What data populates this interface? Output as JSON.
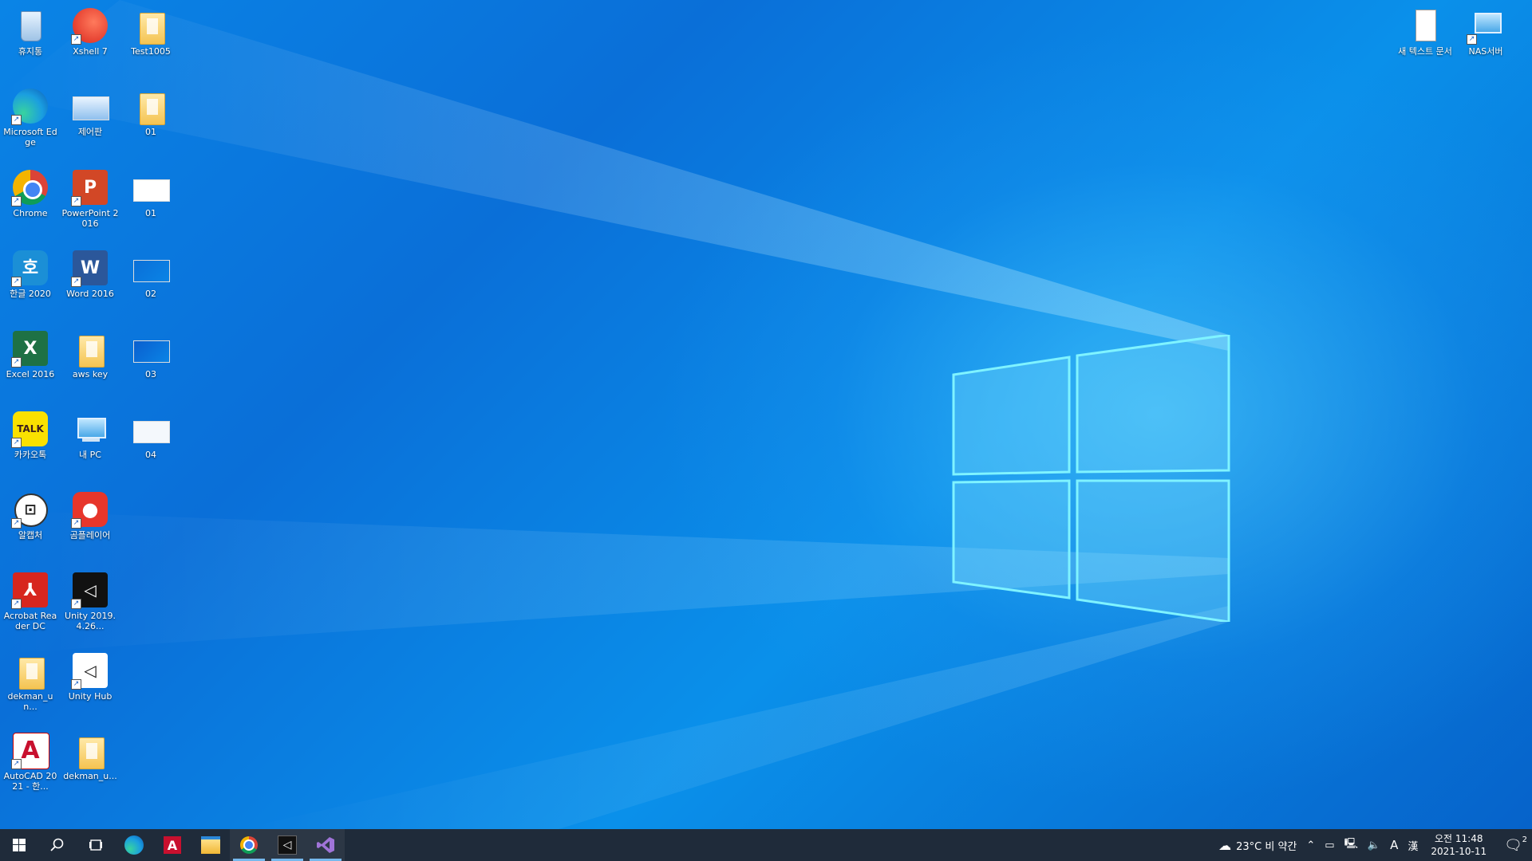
{
  "desktop": {
    "icons_left_col1": [
      {
        "label": "휴지통",
        "icon": "recycle-bin-icon"
      },
      {
        "label": "Microsoft Edge",
        "icon": "edge-icon"
      },
      {
        "label": "Chrome",
        "icon": "chrome-icon"
      },
      {
        "label": "한글 2020",
        "icon": "hangul-icon"
      },
      {
        "label": "Excel 2016",
        "icon": "excel-icon"
      },
      {
        "label": "카카오톡",
        "icon": "kakaotalk-icon"
      },
      {
        "label": "알캡처",
        "icon": "alcapture-icon"
      },
      {
        "label": "Acrobat Reader DC",
        "icon": "acrobat-icon"
      },
      {
        "label": "dekman_un...",
        "icon": "folder-icon"
      },
      {
        "label": "AutoCAD 2021 - 한...",
        "icon": "autocad-icon"
      }
    ],
    "icons_left_col2": [
      {
        "label": "Xshell 7",
        "icon": "xshell-icon"
      },
      {
        "label": "제어판",
        "icon": "control-panel-icon"
      },
      {
        "label": "PowerPoint 2016",
        "icon": "powerpoint-icon"
      },
      {
        "label": "Word 2016",
        "icon": "word-icon"
      },
      {
        "label": "aws key",
        "icon": "folder-icon"
      },
      {
        "label": "내 PC",
        "icon": "this-pc-icon"
      },
      {
        "label": "곰플레이어",
        "icon": "gomplayer-icon"
      },
      {
        "label": "Unity 2019.4.26...",
        "icon": "unity-icon"
      },
      {
        "label": "Unity Hub",
        "icon": "unity-hub-icon"
      },
      {
        "label": "dekman_u...",
        "icon": "folder-icon"
      }
    ],
    "icons_left_col3": [
      {
        "label": "Test1005",
        "icon": "folder-icon"
      },
      {
        "label": "01",
        "icon": "folder-icon"
      },
      {
        "label": "01",
        "icon": "image-file-icon"
      },
      {
        "label": "02",
        "icon": "image-file-icon"
      },
      {
        "label": "03",
        "icon": "image-file-icon"
      },
      {
        "label": "04",
        "icon": "image-file-icon"
      }
    ],
    "icons_right": [
      {
        "label": "새 텍스트 문서",
        "icon": "text-document-icon"
      },
      {
        "label": "NAS서버",
        "icon": "network-computer-icon"
      }
    ]
  },
  "taskbar": {
    "apps": [
      "start-icon",
      "search-icon",
      "task-view-icon",
      "edge-icon",
      "autocad-icon",
      "file-explorer-icon",
      "chrome-icon",
      "unity-icon",
      "visual-studio-icon"
    ],
    "weather": "23°C 비 약간",
    "ime": "A",
    "ime2": "漢",
    "time": "오전 11:48",
    "date": "2021-10-11",
    "notifications": "2"
  },
  "colors": {
    "accent": "#76b9ed",
    "taskbar": "#1f2b3a",
    "desktop": "#0a84e6"
  }
}
